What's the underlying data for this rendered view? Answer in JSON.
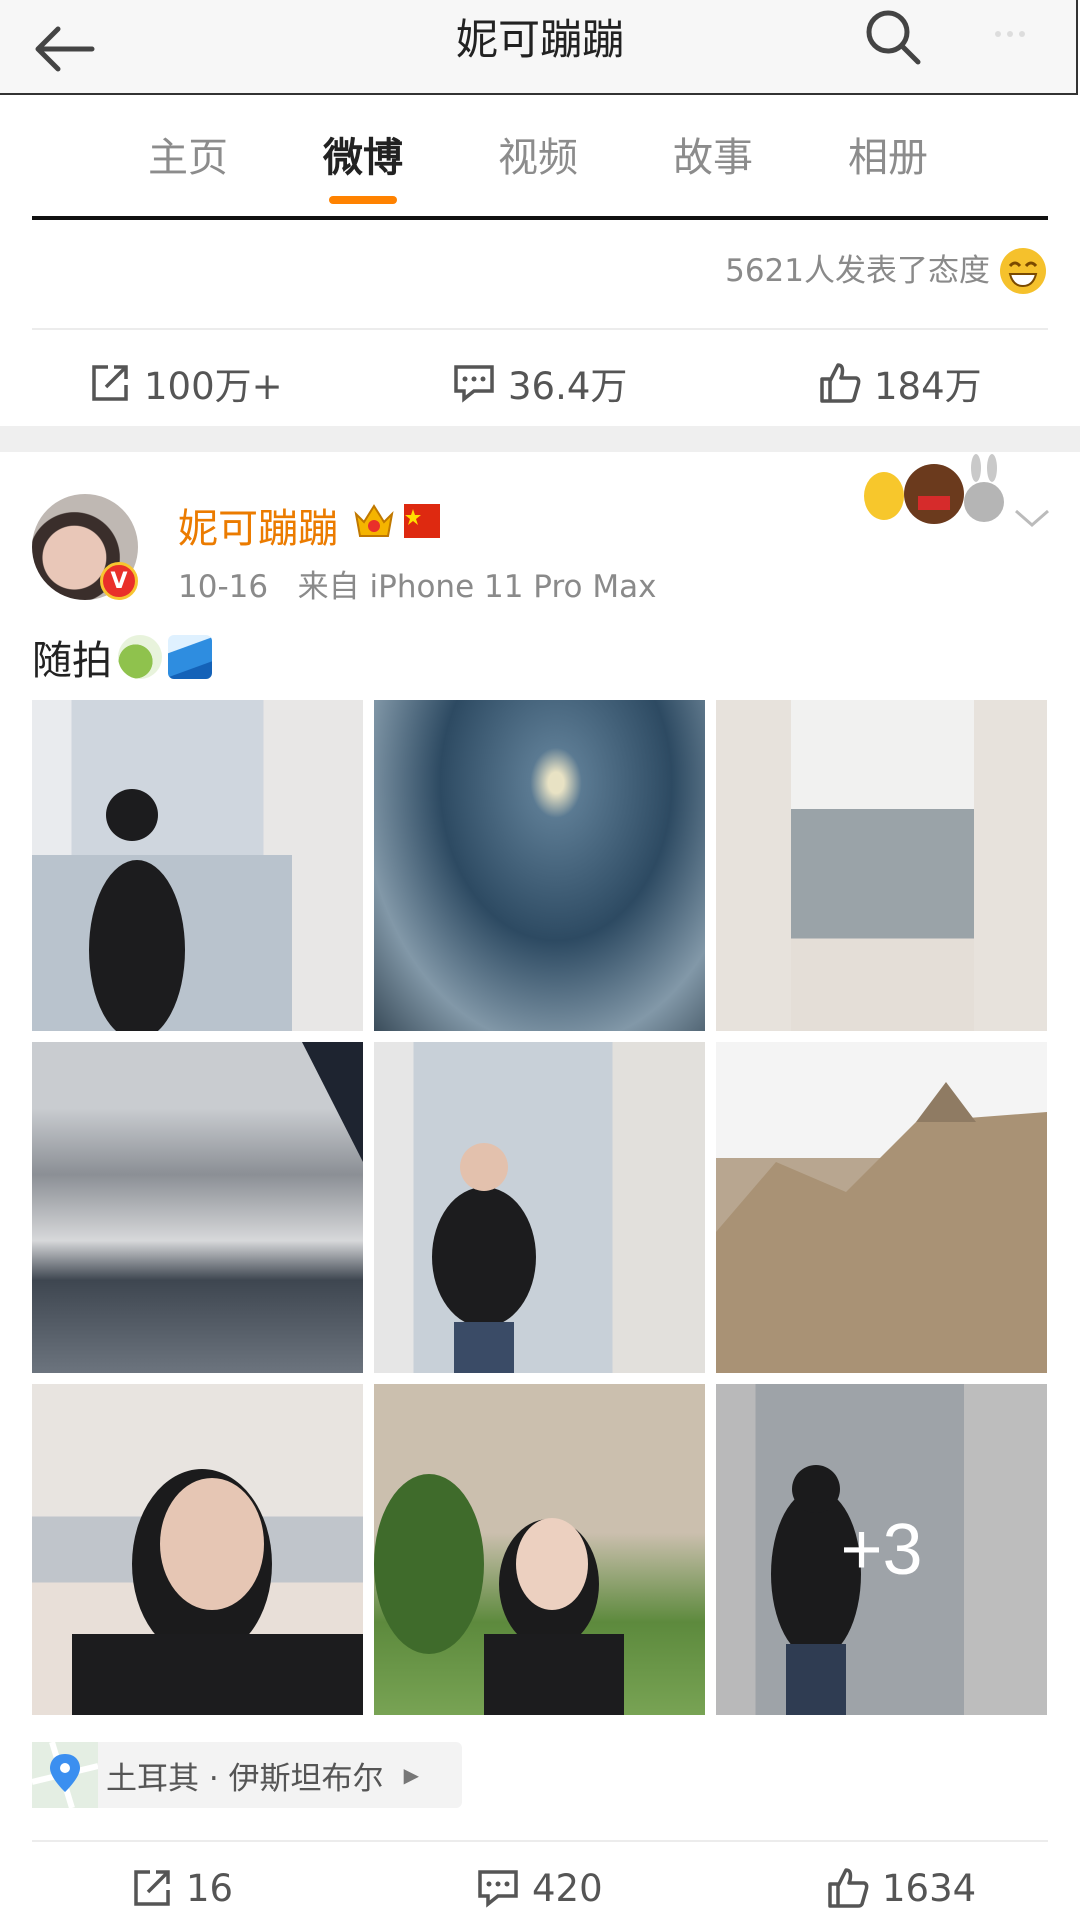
{
  "header": {
    "title": "妮可蹦蹦"
  },
  "tabs": [
    {
      "label": "主页",
      "active": false
    },
    {
      "label": "微博",
      "active": true
    },
    {
      "label": "视频",
      "active": false
    },
    {
      "label": "故事",
      "active": false
    },
    {
      "label": "相册",
      "active": false
    }
  ],
  "prev_post": {
    "attitude_text": "5621人发表了态度",
    "repost_count": "100万+",
    "comment_count": "36.4万",
    "like_count": "184万"
  },
  "post": {
    "username": "妮可蹦蹦",
    "verified_badge": "V",
    "date": "10-16",
    "source": "来自 iPhone 11 Pro Max",
    "text": "随拍",
    "more_photos_label": "+3",
    "location": "土耳其 · 伊斯坦布尔",
    "repost_count": "16",
    "comment_count": "420",
    "like_count": "1634"
  },
  "colors": {
    "accent_orange": "#ff8200",
    "username_orange": "#eb7b00",
    "muted_text": "#8a8a8a"
  }
}
